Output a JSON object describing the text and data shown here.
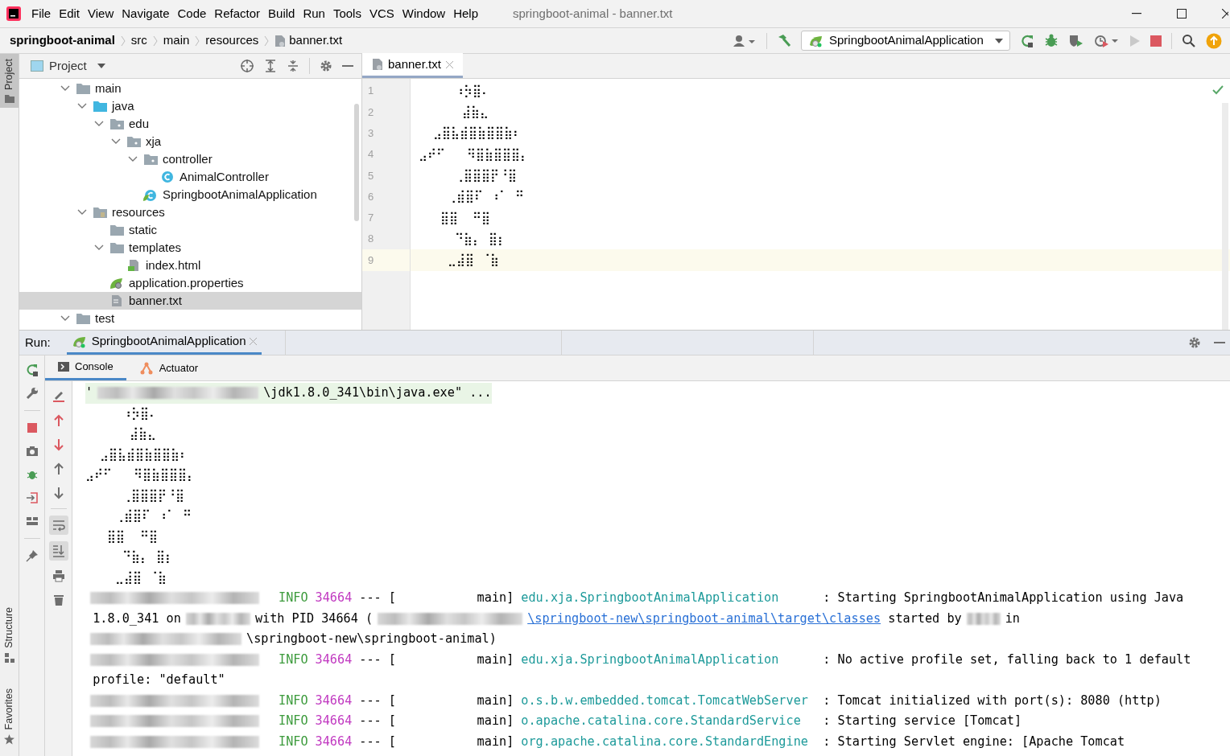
{
  "window": {
    "title": "springboot-animal - banner.txt"
  },
  "menu": [
    "File",
    "Edit",
    "View",
    "Navigate",
    "Code",
    "Refactor",
    "Build",
    "Run",
    "Tools",
    "VCS",
    "Window",
    "Help"
  ],
  "breadcrumbs": [
    {
      "label": "springboot-animal",
      "kind": "project"
    },
    {
      "label": "src",
      "kind": "folder"
    },
    {
      "label": "main",
      "kind": "folder"
    },
    {
      "label": "resources",
      "kind": "folder"
    },
    {
      "label": "banner.txt",
      "kind": "file"
    }
  ],
  "run_config": {
    "label": "SpringbootAnimalApplication"
  },
  "tool_strip": {
    "top": [
      {
        "label": "Project",
        "selected": true
      }
    ],
    "bottom": [
      {
        "label": "Structure",
        "selected": false
      },
      {
        "label": "Favorites",
        "selected": false
      }
    ]
  },
  "project_panel": {
    "title": "Project",
    "tree": [
      {
        "label": "main",
        "kind": "folder",
        "expanded": true,
        "selected": false,
        "children": [
          {
            "label": "java",
            "kind": "source_folder",
            "expanded": true,
            "selected": false,
            "children": [
              {
                "label": "edu",
                "kind": "package",
                "expanded": true,
                "selected": false,
                "children": [
                  {
                    "label": "xja",
                    "kind": "package",
                    "expanded": true,
                    "selected": false,
                    "children": [
                      {
                        "label": "controller",
                        "kind": "package",
                        "expanded": true,
                        "selected": false,
                        "children": [
                          {
                            "label": "AnimalController",
                            "kind": "class",
                            "selected": false
                          }
                        ]
                      },
                      {
                        "label": "SpringbootAnimalApplication",
                        "kind": "spring_class",
                        "selected": false
                      }
                    ]
                  }
                ]
              }
            ]
          },
          {
            "label": "resources",
            "kind": "resource_folder",
            "expanded": true,
            "selected": false,
            "children": [
              {
                "label": "static",
                "kind": "folder",
                "selected": false
              },
              {
                "label": "templates",
                "kind": "folder",
                "expanded": true,
                "selected": false,
                "children": [
                  {
                    "label": "index.html",
                    "kind": "html",
                    "selected": false
                  }
                ]
              },
              {
                "label": "application.properties",
                "kind": "properties",
                "selected": false
              },
              {
                "label": "banner.txt",
                "kind": "text",
                "selected": true
              }
            ]
          }
        ]
      },
      {
        "label": "test",
        "kind": "folder",
        "expanded": true,
        "selected": false
      }
    ]
  },
  "editor": {
    "tabs": [
      {
        "label": "banner.txt",
        "selected": true
      }
    ],
    "lines": [
      {
        "number": "1",
        "text": "     ⠰⡳⣿⠄",
        "current": false
      },
      {
        "number": "2",
        "text": "      ⣼⣷⣄",
        "current": false
      },
      {
        "number": "3",
        "text": "  ⣠⣿⣧⣾⣿⣷⣿⣿⣷⠆",
        "current": false
      },
      {
        "number": "4",
        "text": "⣠⠞⠋   ⠻⣿⣷⣿⣿⣿⡄",
        "current": false
      },
      {
        "number": "5",
        "text": "     ⢀⣿⣿⣿⡟⠘⣿",
        "current": false
      },
      {
        "number": "6",
        "text": "    ⢀⣾⣿⠏ ⠰⠁ ⠛",
        "current": false
      },
      {
        "number": "7",
        "text": "   ⣿⣿  ⠛⣿",
        "current": false
      },
      {
        "number": "8",
        "text": "     ⠙⣷⡄ ⣿⡆",
        "current": false
      },
      {
        "number": "9",
        "text": "    ⣀⣼⣿ ⠈⣷",
        "current": true
      }
    ]
  },
  "run_panel": {
    "label": "Run:",
    "tabs": [
      {
        "label": "SpringbootAnimalApplication",
        "selected": true
      }
    ],
    "console_tabs": [
      {
        "label": "Console",
        "kind": "console",
        "selected": true
      },
      {
        "label": "Actuator",
        "kind": "actuator",
        "selected": false
      }
    ],
    "soft_wrap": {
      "on": true
    },
    "scroll_to_end": {
      "on": true
    },
    "console": [
      {
        "highlighted": true,
        "segments": [
          {
            "kind": "text",
            "text": "'"
          },
          {
            "kind": "blur_jdk"
          },
          {
            "kind": "text",
            "text": "\\jdk1.8.0_341\\bin\\java.exe\" ..."
          }
        ]
      },
      {
        "highlighted": false,
        "segments": [
          {
            "kind": "text",
            "text": "     ⠰⡳⣿⠄"
          }
        ]
      },
      {
        "highlighted": false,
        "segments": [
          {
            "kind": "text",
            "text": "      ⣼⣷⣄"
          }
        ]
      },
      {
        "highlighted": false,
        "segments": [
          {
            "kind": "text",
            "text": "  ⣠⣿⣧⣾⣿⣷⣿⣿⣷⠆"
          }
        ]
      },
      {
        "highlighted": false,
        "segments": [
          {
            "kind": "text",
            "text": "⣠⠞⠋   ⠻⣿⣷⣿⣿⣿⡄"
          }
        ]
      },
      {
        "highlighted": false,
        "segments": [
          {
            "kind": "text",
            "text": "     ⢀⣿⣿⣿⡟⠘⣿"
          }
        ]
      },
      {
        "highlighted": false,
        "segments": [
          {
            "kind": "text",
            "text": "    ⢀⣾⣿⠏ ⠰⠁ ⠛"
          }
        ]
      },
      {
        "highlighted": false,
        "segments": [
          {
            "kind": "text",
            "text": "   ⣿⣿  ⠛⣿"
          }
        ]
      },
      {
        "highlighted": false,
        "segments": [
          {
            "kind": "text",
            "text": "     ⠙⣷⡄ ⣿⡆"
          }
        ]
      },
      {
        "highlighted": false,
        "segments": [
          {
            "kind": "text",
            "text": "    ⣀⣼⣿ ⠈⣷"
          }
        ]
      },
      {
        "highlighted": false,
        "segments": [
          {
            "kind": "blur_time"
          },
          {
            "kind": "level",
            "text": "INFO"
          },
          {
            "kind": "pid",
            "text": "34664"
          },
          {
            "kind": "thread",
            "text": "--- [           main]"
          },
          {
            "kind": "logger",
            "text": "edu.xja.SpringbootAnimalApplication"
          },
          {
            "kind": "text",
            "text": ": Starting SpringbootAnimalApplication using Java"
          }
        ]
      },
      {
        "highlighted": false,
        "segments": [
          {
            "kind": "text",
            "text": " 1.8.0_341 on"
          },
          {
            "kind": "blur_host"
          },
          {
            "kind": "text",
            "text": "with PID 34664 ("
          },
          {
            "kind": "blur_path"
          },
          {
            "kind": "link",
            "text": "\\springboot-new\\springboot-animal\\target\\classes"
          },
          {
            "kind": "text",
            "text": " started by"
          },
          {
            "kind": "blur_user"
          },
          {
            "kind": "text",
            "text": "in"
          }
        ]
      },
      {
        "highlighted": false,
        "segments": [
          {
            "kind": "blur_dir"
          },
          {
            "kind": "text",
            "text": "\\springboot-new\\springboot-animal)"
          }
        ]
      },
      {
        "highlighted": false,
        "segments": [
          {
            "kind": "blur_time"
          },
          {
            "kind": "level",
            "text": "INFO"
          },
          {
            "kind": "pid",
            "text": "34664"
          },
          {
            "kind": "thread",
            "text": "--- [           main]"
          },
          {
            "kind": "logger",
            "text": "edu.xja.SpringbootAnimalApplication"
          },
          {
            "kind": "text",
            "text": ": No active profile set, falling back to 1 default"
          }
        ]
      },
      {
        "highlighted": false,
        "segments": [
          {
            "kind": "text",
            "text": " profile: \"default\""
          }
        ]
      },
      {
        "highlighted": false,
        "segments": [
          {
            "kind": "blur_time"
          },
          {
            "kind": "level",
            "text": "INFO"
          },
          {
            "kind": "pid",
            "text": "34664"
          },
          {
            "kind": "thread",
            "text": "--- [           main]"
          },
          {
            "kind": "logger",
            "text": "o.s.b.w.embedded.tomcat.TomcatWebServer"
          },
          {
            "kind": "text",
            "text": ": Tomcat initialized with port(s): 8080 (http)"
          }
        ]
      },
      {
        "highlighted": false,
        "segments": [
          {
            "kind": "blur_time"
          },
          {
            "kind": "level",
            "text": "INFO"
          },
          {
            "kind": "pid",
            "text": "34664"
          },
          {
            "kind": "thread",
            "text": "--- [           main]"
          },
          {
            "kind": "logger",
            "text": "o.apache.catalina.core.StandardService"
          },
          {
            "kind": "text",
            "text": ": Starting service [Tomcat]"
          }
        ]
      },
      {
        "highlighted": false,
        "segments": [
          {
            "kind": "blur_time"
          },
          {
            "kind": "level",
            "text": "INFO"
          },
          {
            "kind": "pid",
            "text": "34664"
          },
          {
            "kind": "thread",
            "text": "--- [           main]"
          },
          {
            "kind": "logger",
            "text": "org.apache.catalina.core.StandardEngine"
          },
          {
            "kind": "text",
            "text": ": Starting Servlet engine: [Apache Tomcat"
          }
        ]
      }
    ]
  }
}
